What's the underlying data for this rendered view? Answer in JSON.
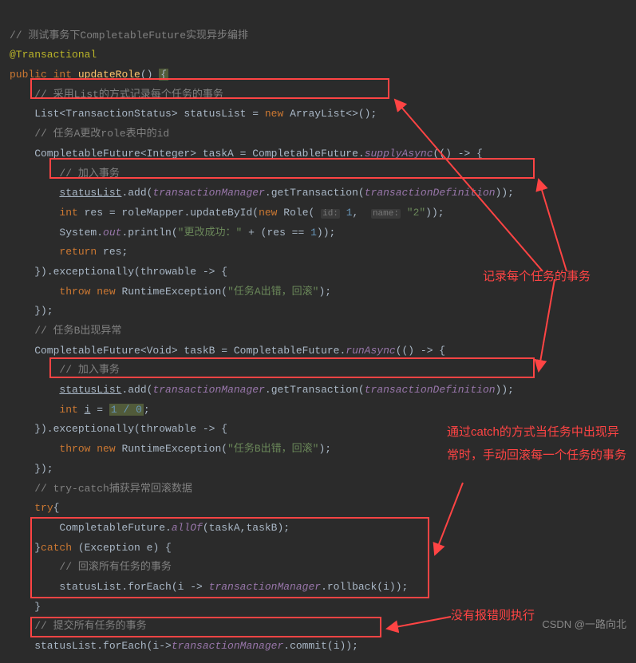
{
  "code": {
    "c1": "// 测试事务下CompletableFuture实现异步编排",
    "c2": "@Transactional",
    "c3_1": "public",
    "c3_2": "int",
    "c3_3": "updateRole",
    "c3_4": "() ",
    "c3_brace": "{",
    "c4": "    // 采用List的方式记录每个任务的事务",
    "c5_1": "    List<TransactionStatus> statusList = ",
    "c5_2": "new",
    "c5_3": " ArrayList<>();",
    "c6": "    // 任务A更改role表中的id",
    "c7_1": "    CompletableFuture<Integer> taskA = CompletableFuture.",
    "c7_2": "supplyAsync",
    "c7_3": "(() -> {",
    "c8": "        // 加入事务",
    "c9_1": "        ",
    "c9_2": "statusList",
    "c9_3": ".add(",
    "c9_4": "transactionManager",
    "c9_5": ".getTransaction(",
    "c9_6": "transactionDefinition",
    "c9_7": "));",
    "c10_1": "        ",
    "c10_2": "int",
    "c10_3": " res = roleMapper.updateById(",
    "c10_4": "new",
    "c10_5": " Role( ",
    "c10_h1": "id:",
    "c10_6": " ",
    "c10_7": "1",
    "c10_8": ",  ",
    "c10_h2": "name:",
    "c10_9": " ",
    "c10_10": "\"2\"",
    "c10_11": "));",
    "c11_1": "        System.",
    "c11_2": "out",
    "c11_3": ".println(",
    "c11_4": "\"更改成功：\"",
    "c11_5": " + (res == ",
    "c11_6": "1",
    "c11_7": "));",
    "c12_1": "        ",
    "c12_2": "return",
    "c12_3": " res;",
    "c13": "    }).exceptionally(throwable -> {",
    "c14_1": "        ",
    "c14_2": "throw new",
    "c14_3": " RuntimeException(",
    "c14_4": "\"任务A出错，回滚\"",
    "c14_5": ");",
    "c15": "    });",
    "c16": "    // 任务B出现异常",
    "c17_1": "    CompletableFuture<Void> taskB = CompletableFuture.",
    "c17_2": "runAsync",
    "c17_3": "(() -> {",
    "c18": "        // 加入事务",
    "c19_1": "        ",
    "c19_2": "statusList",
    "c19_3": ".add(",
    "c19_4": "transactionManager",
    "c19_5": ".getTransaction(",
    "c19_6": "transactionDefinition",
    "c19_7": "));",
    "c20_1": "        ",
    "c20_2": "int",
    "c20_3": " ",
    "c20_i": "i",
    "c20_4": " = ",
    "c20_5": "1 / 0",
    "c20_6": ";",
    "c21": "    }).exceptionally(throwable -> {",
    "c22_1": "        ",
    "c22_2": "throw new",
    "c22_3": " RuntimeException(",
    "c22_4": "\"任务B出错，回滚\"",
    "c22_5": ");",
    "c23": "    });",
    "c24": "    // try-catch捕获异常回滚数据",
    "c25_1": "    ",
    "c25_2": "try",
    "c25_3": "{",
    "c26_1": "        CompletableFuture.",
    "c26_2": "allOf",
    "c26_3": "(taskA,taskB);",
    "c27_1": "    }",
    "c27_2": "catch",
    "c27_3": " (Exception e) {",
    "c28": "        // 回滚所有任务的事务",
    "c29_1": "        statusList.forEach(i -> ",
    "c29_2": "transactionManager",
    "c29_3": ".rollback(i));",
    "c30": "    }",
    "c31": "    // 提交所有任务的事务",
    "c32_1": "    statusList.forEach(i->",
    "c32_2": "transactionManager",
    "c32_3": ".commit(i));"
  },
  "annotations": {
    "a1": "记录每个任务的事务",
    "a2": "通过catch的方式当任务中出现异常时，手动回滚每一个任务的事务",
    "a3": "没有报错则执行"
  },
  "watermark": "CSDN @一路向北⁠"
}
